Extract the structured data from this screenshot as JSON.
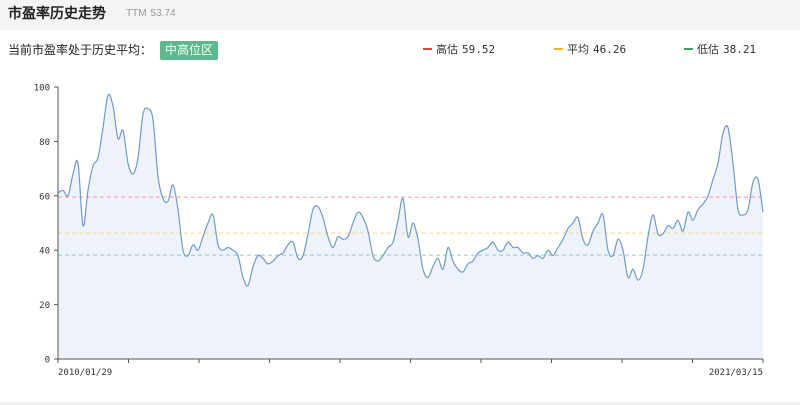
{
  "header": {
    "title": "市盈率历史走势",
    "ttm_label": "TTM",
    "ttm_value": "53.74"
  },
  "status": {
    "label": "当前市盈率处于历史平均：",
    "badge": "中高位区"
  },
  "legend": [
    {
      "label": "高估",
      "value": "59.52",
      "color": "#e9413b"
    },
    {
      "label": "平均",
      "value": "46.26",
      "color": "#f0b429"
    },
    {
      "label": "低估",
      "value": "38.21",
      "color": "#3aa957"
    }
  ],
  "colors": {
    "series_line": "#6f9ad3",
    "series_fill": "#eef2fb",
    "high_line": "#f19b9b",
    "avg_line": "#f5d98a",
    "low_line": "#8fd0c6",
    "axis": "#555555"
  },
  "chart_data": {
    "type": "area",
    "title": "市盈率历史走势",
    "xlabel": "",
    "ylabel": "",
    "ylim": [
      0,
      100
    ],
    "yticks": [
      0,
      20,
      40,
      60,
      80,
      100
    ],
    "x_tick_labels": [
      "2010/01/29",
      "2021/03/15"
    ],
    "x_range": [
      "2010/01/29",
      "2021/03/15"
    ],
    "grid": false,
    "reference_lines": [
      {
        "label": "高估",
        "value": 59.52
      },
      {
        "label": "平均",
        "value": 46.26
      },
      {
        "label": "低估",
        "value": 38.21
      }
    ],
    "series": [
      {
        "values": [
          61,
          62,
          60,
          68,
          72,
          49,
          62,
          71,
          74,
          85,
          97,
          93,
          81,
          84,
          72,
          68,
          74,
          90,
          92,
          88,
          67,
          59,
          58,
          64,
          55,
          40,
          38,
          42,
          40,
          45,
          50,
          53,
          42,
          40,
          41,
          40,
          38,
          30,
          27,
          34,
          38,
          37,
          35,
          36,
          38,
          39,
          42,
          43,
          37,
          38,
          46,
          55,
          56,
          52,
          45,
          41,
          45,
          44,
          45,
          50,
          54,
          52,
          47,
          38,
          36,
          38,
          41,
          43,
          51,
          59,
          45,
          50,
          44,
          33,
          30,
          34,
          37,
          33,
          41,
          36,
          33,
          32,
          35,
          36,
          39,
          40,
          41,
          43,
          40,
          40,
          43,
          41,
          41,
          39,
          39,
          37,
          38,
          37,
          40,
          38,
          41,
          44,
          48,
          50,
          52,
          44,
          42,
          47,
          50,
          53,
          40,
          38,
          44,
          40,
          30,
          33,
          29,
          33,
          45,
          53,
          46,
          46,
          49,
          48,
          51,
          47,
          54,
          51,
          55,
          57,
          60,
          66,
          72,
          83,
          85,
          72,
          55,
          53,
          55,
          65,
          66,
          54
        ]
      }
    ]
  }
}
